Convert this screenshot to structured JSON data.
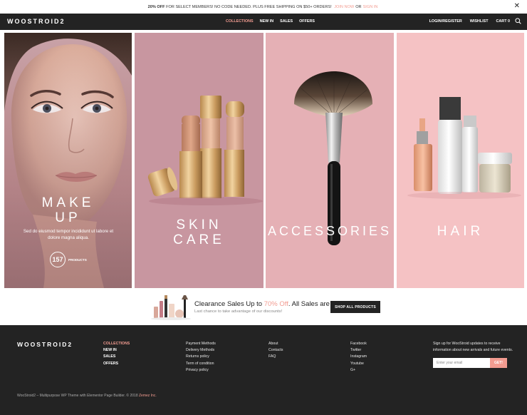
{
  "topbar": {
    "bold": "20% OFF",
    "text": "FOR SELECT MEMBERS! NO CODE NEEDED. PLUS FREE SHIPPING ON $50+ ORDERS!",
    "join": "JOIN NOW",
    "or": "OR",
    "signin": "SIGN IN",
    "close": "✕"
  },
  "nav": {
    "logo": "WOOSTROID2",
    "menu": [
      "COLLECTIONS",
      "NEW IN",
      "SALES",
      "OFFERS"
    ],
    "login": "LOGIN/REGISTER",
    "wishlist": "WISHLIST",
    "cart": "CART",
    "cart_count": "0"
  },
  "panels": {
    "makeup": {
      "title1": "MAKE",
      "title2": "UP",
      "desc": "Sed do eiusmod tempor incididunt ut labore et dolore magna aliqua.",
      "count": "157",
      "count_label": "PRODUCTS"
    },
    "skincare": {
      "title1": "SKIN",
      "title2": "CARE"
    },
    "accessories": {
      "title": "ACCESSORIES"
    },
    "hair": {
      "title": "HAIR"
    }
  },
  "promo": {
    "title_a": "Clearance Sales Up to",
    "title_pct": "70% Off",
    "title_b": ". All Sales are Final!",
    "sub": "Last chance to take advantage of our discounts!",
    "button": "SHOP ALL PRODUCTS"
  },
  "footer": {
    "logo": "WOOSTROID2",
    "menu": [
      "COLLECTIONS",
      "NEW IN",
      "SALES",
      "OFFERS"
    ],
    "info": [
      "Payment Methods",
      "Delivery Methods",
      "Returns policy",
      "Term of condition",
      "Privacy policy"
    ],
    "help": [
      "About",
      "Contacts",
      "FAQ"
    ],
    "social": [
      "Facebook",
      "Twitter",
      "Instagram",
      "Youtube",
      "G+"
    ],
    "signup": "Sign up for WooStroid updates to receive information about new arrivals and future events.",
    "email_placeholder": "Enter your email",
    "email_button": "GET!",
    "copyright": "WooStroid2 – Multipurpose WP Theme with Elementor Page Builder. © 2018",
    "company": "Zemez Inc."
  },
  "colors": {
    "accent": "#f39c91",
    "dark": "#232323"
  }
}
